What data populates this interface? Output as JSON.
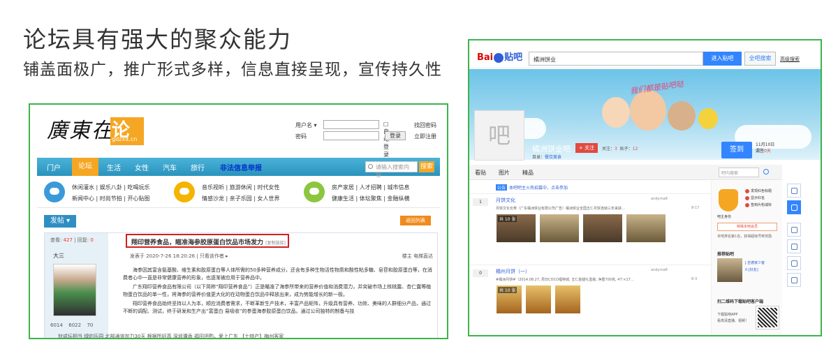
{
  "headline": "论坛具有强大的聚众能力",
  "subheadline": "铺盖面极广，推广形式多样，信息直接呈现，宣传持久性",
  "forum": {
    "logo_text": "廣東在線",
    "logo_box": "论坛",
    "logo_domain": "gdzxlt.cn",
    "login": {
      "username_label": "用户名 ▾",
      "password_label": "密码",
      "auto_login": "自动登录",
      "login_button": "登录",
      "find_password": "找回密码",
      "register": "立即注册"
    },
    "nav": [
      "门户",
      "论坛",
      "生活",
      "女性",
      "汽车",
      "旅行"
    ],
    "nav_report": "非法信息举报",
    "search_placeholder": "请输入搜索内容",
    "search_button": "搜索",
    "categories": {
      "group1_row1": "休闲灌水 | 娱乐八卦 | 吃喝玩乐",
      "group1_row2": "新闻中心 | 时尚节拍 | 开心贴图",
      "group2_row1": "音乐视听 | 旅游休闲 | 时代女性",
      "group2_row2": "情感沙龙 | 亲子乐园 | 女人世界",
      "group3_row1": "房产家居 | 人才招聘 | 城市信息",
      "group3_row2": "健康生活 | 体坛聚焦 | 金融纵横"
    },
    "post_button": "发帖 ▾",
    "back_button": "返回列表",
    "stats": {
      "view_label": "查看:",
      "views": "427",
      "reply_label": "| 回复:",
      "replies": "0"
    },
    "username": "大三",
    "user_numbers": [
      "6014",
      "6022",
      "70"
    ],
    "thread_title": "翔印营养食品，瞄准海参胶原蛋白饮品市场发力",
    "copy_link": "[复制链接]",
    "meta": "发表于 2020-7-26 18:20:26 | 只看该作者 ▸",
    "meta_right": "楼主  电梯直达",
    "body": [
      "海参因其富含氨基酸、维生素和胶原蛋白等人体所需的50多种营养成分，还含有多种生物活性物质和酸性粘多糖、皂苷和胶原蛋白等，在消费者心中一直是非常健康营养的形象，也逐渐被应用于营养品中。",
      "广东翔印营养食品有限公司（以下简称“翔印营养食品”）正是瞄准了海参所带来的营养价值和消费潜力，并突破市场上核桃露、杏仁露等植物蛋白饮品的单一性，将海参的营养价值更大化的在动物蛋白饮品中释放出来，成为势能增长的新一极。",
      "翔印营养食品始终坚持以人为本，顺应消费者需求，不断革新生产技术，丰富产品矩阵，升级具有营养、功效、美味的人群细分产品，通过不断的调配、测试，终于研发和生产出“富蛋白 易吸收”的参蛋海参胶原蛋白饮品。通过公司独特的制备与技"
    ],
    "footer": "封成坛相当  绿的乐园        北部通道加力30天       根据所好高  深圳谭香       福田坦酌，爱上广东      【土特产】梅州客家"
  },
  "tieba": {
    "logo_a": "Bai",
    "logo_b": "du",
    "logo_c": "贴吧",
    "search_value": "橘洲饼业",
    "enter_button": "进入贴吧",
    "all_search_button": "全吧搜索",
    "advanced": "高级搜索",
    "banner_slogan": "我们都是贴吧哒",
    "avatar_char": "吧",
    "bar_name": "橘洲饼业吧",
    "follow_button": "+ 关注",
    "counts_prefix": "关注：",
    "follow_count": "3",
    "counts_mid": "贴子：",
    "post_count": "12",
    "dir_label": "目录：",
    "dir_value": "餐饮美食",
    "sign_button": "签到",
    "date_line": "11月10日",
    "date_sub": "漏签",
    "date_days": "0天",
    "tabs": [
      "看贴",
      "图片",
      "精品"
    ],
    "tab_search_placeholder": "吧内搜索",
    "notice_tag": "公告",
    "notice": "本吧吧主火热招募中，点击参加",
    "threads": [
      {
        "count": "1",
        "title": "月饼文化",
        "desc": "月饼文化长寿（广东橘洲饼业有限公司广告）橘洲饼业全国五仁月饼连锁三年来获…",
        "author": "andyrna8",
        "date": "8-17",
        "images": [
          "共 10 张",
          "",
          "",
          ""
        ]
      },
      {
        "count": "0",
        "title": "橘州月饼（一）",
        "desc": "#橘洲月饼#（2014.08.27, 周日COCO福特城, 五仁金腿礼盒装, 净重700克, 4个×17…",
        "author": "andyrna8",
        "date": "8-3",
        "images": [
          "共 10 张",
          "",
          ""
        ]
      }
    ],
    "side": {
      "crown_label": "吧主身份",
      "privileges": [
        "发现红色标题",
        "显示红名",
        "签到片粉减铃"
      ],
      "member_button": "特殊本吧会员",
      "ranking_prefix": "本吧排名第",
      "ranking": "1",
      "ranking_suffix": "名，获得超级号称奖励",
      "recommend_title": "推荐贴吧",
      "recommend_lines": [
        "J.吉德家少客",
        "0.[好友]"
      ],
      "app_title": "扫二维码下载贴吧客户端",
      "app_line1": "下载贴吧APP",
      "app_line2": "看高清直播、视频！"
    }
  },
  "colors": {
    "frame": "#3cb44b",
    "forum_nav": "#2a93bd",
    "accent_orange": "#f5a623",
    "title_red": "#d02020",
    "baidu_blue": "#3385ff"
  }
}
